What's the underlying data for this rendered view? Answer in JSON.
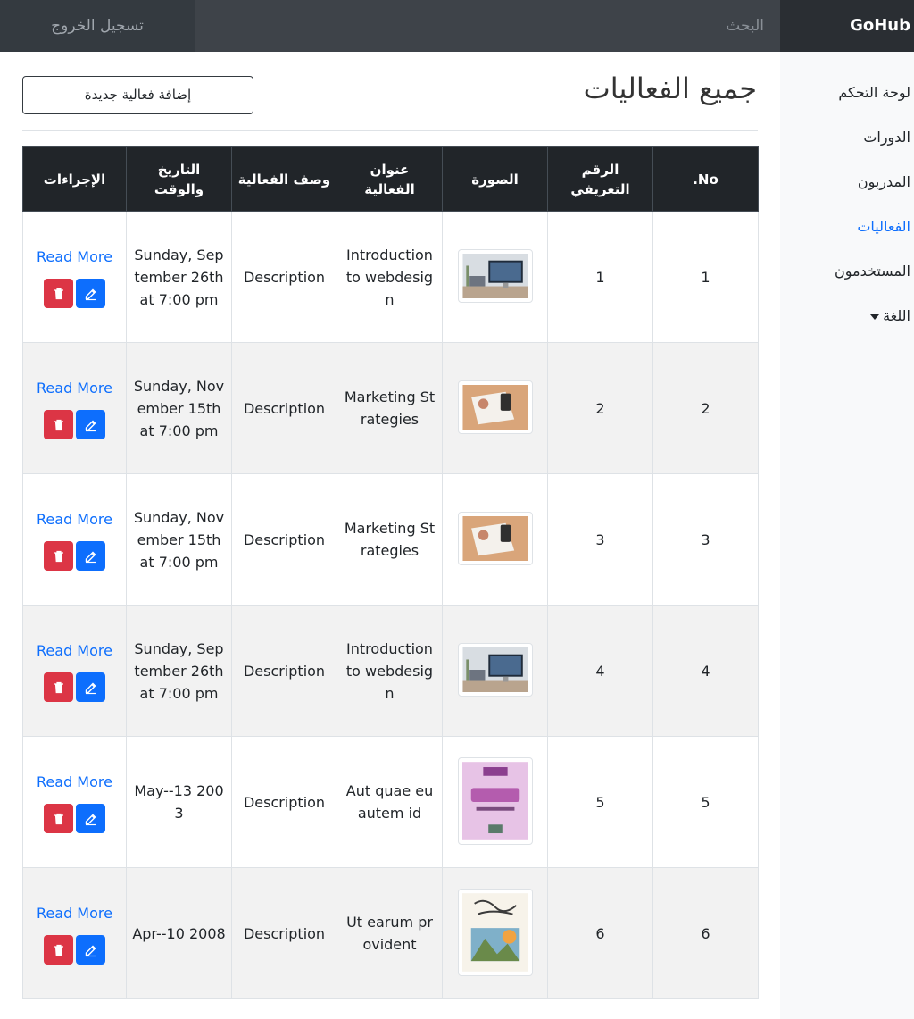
{
  "app": {
    "brand": "GoHub",
    "search_placeholder": "البحث",
    "logout_label": "تسجيل الخروج"
  },
  "sidebar": {
    "items": [
      {
        "label": "لوحة التحكم",
        "active": false
      },
      {
        "label": "الدورات",
        "active": false
      },
      {
        "label": "المدربون",
        "active": false
      },
      {
        "label": "الفعاليات",
        "active": true
      },
      {
        "label": "المستخدمون",
        "active": false
      },
      {
        "label": "اللغة",
        "active": false,
        "dropdown": true
      }
    ]
  },
  "page": {
    "title": "جميع الفعاليات",
    "add_button_label": "إضافة فعالية جديدة"
  },
  "table": {
    "headers": [
      "No.",
      "الرقم التعريفي",
      "الصورة",
      "عنوان الفعالية",
      "وصف الفعالية",
      "التاريخ والوقت",
      "الإجراءات"
    ],
    "read_more_label": "Read More",
    "rows": [
      {
        "no": "1",
        "id": "1",
        "image": "desk-computer",
        "title": "Introduction to webdesign",
        "description": "Description",
        "datetime": "Sunday, September 26th at 7:00 pm"
      },
      {
        "no": "2",
        "id": "2",
        "image": "marketing-desk",
        "title": "Marketing Strategies",
        "description": "Description",
        "datetime": "Sunday, November 15th at 7:00 pm"
      },
      {
        "no": "3",
        "id": "3",
        "image": "marketing-desk",
        "title": "Marketing Strategies",
        "description": "Description",
        "datetime": "Sunday, November 15th at 7:00 pm"
      },
      {
        "no": "4",
        "id": "4",
        "image": "desk-computer",
        "title": "Introduction to webdesign",
        "description": "Description",
        "datetime": "Sunday, September 26th at 7:00 pm"
      },
      {
        "no": "5",
        "id": "5",
        "image": "book-cover-pink",
        "title": "Aut quae eu autem id",
        "description": "Description",
        "datetime": "May--13 2003"
      },
      {
        "no": "6",
        "id": "6",
        "image": "book-cover-landscape",
        "title": "Ut earum provident",
        "description": "Description",
        "datetime": "Apr--10 2008"
      }
    ]
  },
  "icons": {
    "delete": "trash-icon",
    "edit": "edit-icon",
    "dropdown": "caret-down-icon"
  },
  "colors": {
    "primary": "#0d6efd",
    "danger": "#dc3545",
    "navbar": "#343a40",
    "table_header": "#212529"
  }
}
